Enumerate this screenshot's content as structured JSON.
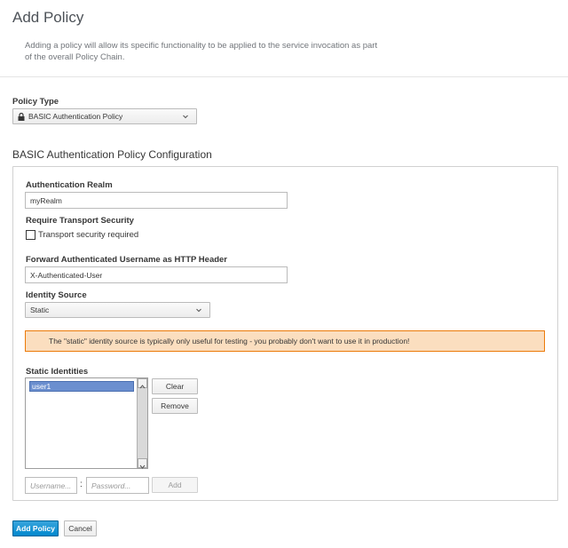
{
  "header": {
    "title": "Add Policy",
    "intro": "Adding a policy will allow its specific functionality to be applied to the service invocation as part of the overall Policy Chain."
  },
  "policy_type": {
    "label": "Policy Type",
    "selected": "BASIC Authentication Policy",
    "icon": "lock-icon"
  },
  "config": {
    "title": "BASIC Authentication Policy Configuration",
    "realm": {
      "label": "Authentication Realm",
      "value": "myRealm"
    },
    "transport": {
      "label": "Require Transport Security",
      "checkbox_label": "Transport security required",
      "checked": false
    },
    "forward_header": {
      "label": "Forward Authenticated Username as HTTP Header",
      "value": "X-Authenticated-User"
    },
    "identity_source": {
      "label": "Identity Source",
      "selected": "Static"
    },
    "warning": "The \"static\" identity source is typically only useful for testing - you probably don't want to use it in production!",
    "static_identities": {
      "label": "Static Identities",
      "items": [
        "user1"
      ],
      "clear_label": "Clear",
      "remove_label": "Remove",
      "username_placeholder": "Username...",
      "password_placeholder": "Password...",
      "separator": ":",
      "add_label": "Add"
    }
  },
  "footer": {
    "add_policy_label": "Add Policy",
    "cancel_label": "Cancel"
  },
  "colors": {
    "primary": "#0088ce",
    "warning_border": "#ec7a08",
    "warning_bg": "#fbdebf",
    "selection": "#6b8fcf"
  }
}
